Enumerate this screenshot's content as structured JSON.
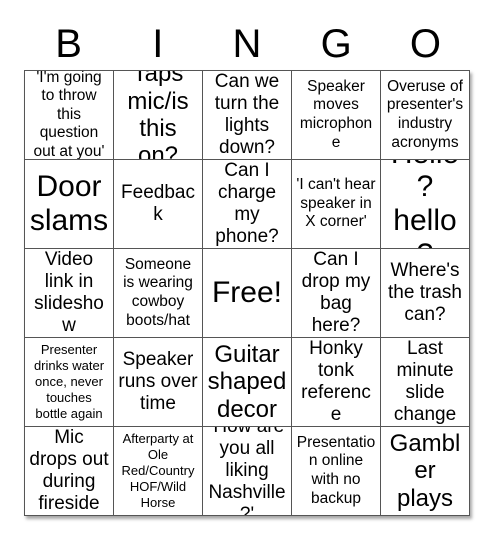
{
  "card": {
    "header_letters": [
      "B",
      "I",
      "N",
      "G",
      "O"
    ],
    "rows": [
      [
        {
          "text": "'I'm going to throw this question out at you'",
          "size": "sm"
        },
        {
          "text": "Taps mic/is this on?",
          "size": "lg"
        },
        {
          "text": "Can we turn the lights down?",
          "size": "md"
        },
        {
          "text": "Speaker moves microphone",
          "size": "sm"
        },
        {
          "text": "Overuse of presenter's industry acronyms",
          "size": "sm"
        }
      ],
      [
        {
          "text": "Door slams",
          "size": "xl"
        },
        {
          "text": "Feedback",
          "size": "md"
        },
        {
          "text": "Can I charge my phone?",
          "size": "md"
        },
        {
          "text": "'I can't hear speaker in X corner'",
          "size": "sm"
        },
        {
          "text": "Hello? hello?",
          "size": "xl"
        }
      ],
      [
        {
          "text": "Video link in slideshow",
          "size": "md"
        },
        {
          "text": "Someone is wearing cowboy boots/hat",
          "size": "sm"
        },
        {
          "text": "Free!",
          "size": "xl"
        },
        {
          "text": "Can I drop my bag here?",
          "size": "md"
        },
        {
          "text": "Where's the trash can?",
          "size": "md"
        }
      ],
      [
        {
          "text": "Presenter drinks water once, never touches bottle again",
          "size": "xs"
        },
        {
          "text": "Speaker runs over time",
          "size": "md"
        },
        {
          "text": "Guitar shaped decor",
          "size": "lg"
        },
        {
          "text": "Honky tonk reference",
          "size": "md"
        },
        {
          "text": "Last minute slide change",
          "size": "md"
        }
      ],
      [
        {
          "text": "Mic drops out during fireside",
          "size": "md"
        },
        {
          "text": "Afterparty at Ole Red/Country HOF/Wild Horse",
          "size": "xs"
        },
        {
          "text": "'How are you all liking Nashville?'",
          "size": "md"
        },
        {
          "text": "Presentation online with no backup",
          "size": "sm"
        },
        {
          "text": "Gambler plays",
          "size": "lg"
        }
      ]
    ]
  },
  "colors": {
    "text": "#000000",
    "border": "#555555",
    "background": "#ffffff"
  }
}
